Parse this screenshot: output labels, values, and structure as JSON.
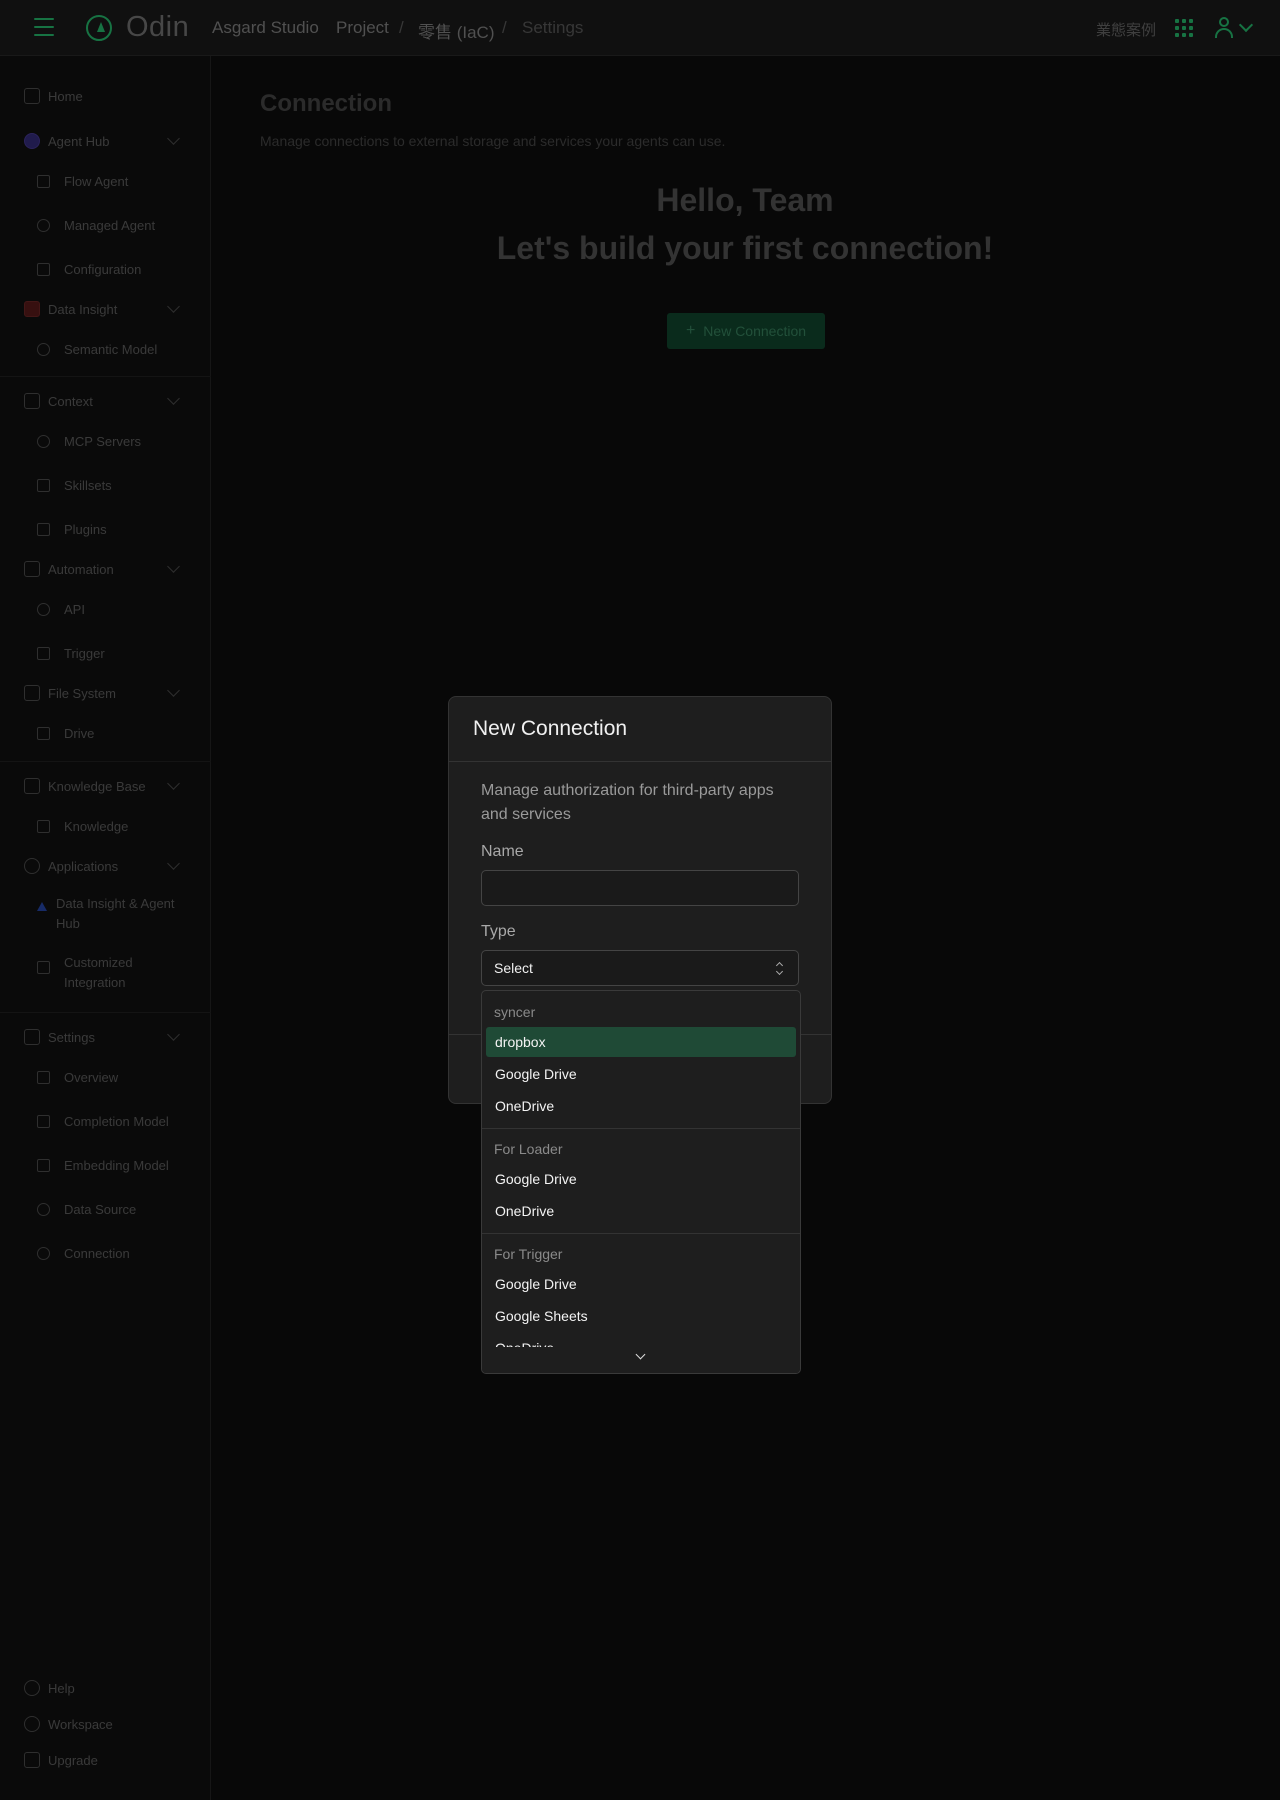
{
  "topbar": {
    "logo_text": "Odin",
    "breadcrumb": [
      "Asgard Studio",
      "Project",
      "零售 (IaC)",
      "Settings"
    ],
    "right_text": "業態案例"
  },
  "sidebar": {
    "home": "Home",
    "agent_hub": "Agent Hub",
    "flow_agent": "Flow Agent",
    "managed_agent": "Managed Agent",
    "configuration": "Configuration",
    "data_insight": "Data Insight",
    "semantic_model": "Semantic Model",
    "context": "Context",
    "mcp_servers": "MCP Servers",
    "skillsets": "Skillsets",
    "plugins": "Plugins",
    "automation": "Automation",
    "api": "API",
    "trigger": "Trigger",
    "file_system": "File System",
    "drive": "Drive",
    "knowledge_base": "Knowledge Base",
    "knowledge": "Knowledge",
    "applications": "Applications",
    "data_insight_agent_hub": "Data Insight & Agent Hub",
    "customized_integration": "Customized Integration",
    "settings": "Settings",
    "overview": "Overview",
    "completion_model": "Completion Model",
    "embedding_model": "Embedding Model",
    "data_source": "Data Source",
    "connection": "Connection",
    "help": "Help",
    "workspace": "Workspace",
    "upgrade": "Upgrade"
  },
  "main": {
    "title": "Connection",
    "subtitle": "Manage connections to external storage and services your agents can use.",
    "hello": "Hello, Team",
    "cta_heading": "Let's build your first connection!",
    "new_connection_button": "New Connection"
  },
  "modal": {
    "title": "New Connection",
    "description": "Manage authorization for third-party apps and services",
    "name_label": "Name",
    "name_value": "",
    "type_label": "Type",
    "type_value": "Select"
  },
  "dropdown": {
    "groups": [
      {
        "label": "syncer",
        "options": [
          "dropbox",
          "Google Drive",
          "OneDrive"
        ]
      },
      {
        "label": "For Loader",
        "options": [
          "Google Drive",
          "OneDrive"
        ]
      },
      {
        "label": "For Trigger",
        "options": [
          "Google Drive",
          "Google Sheets",
          "OneDrive"
        ]
      }
    ],
    "highlighted": "dropbox"
  },
  "colors": {
    "accent": "#1f9a5a",
    "highlight": "#1f4a36",
    "modal_bg": "#1e1e1e"
  }
}
